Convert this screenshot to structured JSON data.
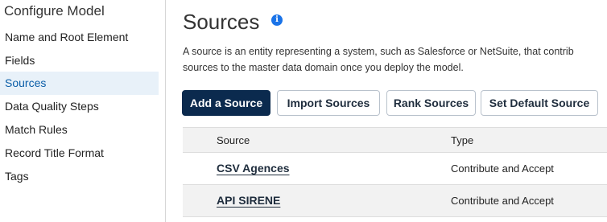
{
  "sidebar": {
    "title": "Configure Model",
    "items": [
      {
        "label": "Name and Root Element"
      },
      {
        "label": "Fields"
      },
      {
        "label": "Sources"
      },
      {
        "label": "Data Quality Steps"
      },
      {
        "label": "Match Rules"
      },
      {
        "label": "Record Title Format"
      },
      {
        "label": "Tags"
      }
    ],
    "active": "Sources"
  },
  "main": {
    "title": "Sources",
    "info_icon": "info-icon",
    "description_line1": "A source is an entity representing a system, such as Salesforce or NetSuite, that contrib",
    "description_line2": "sources to the master data domain once you deploy the model.",
    "buttons": {
      "add": "Add a Source",
      "import": "Import Sources",
      "rank": "Rank Sources",
      "set_default": "Set Default Source"
    },
    "table": {
      "headers": {
        "source": "Source",
        "type": "Type"
      },
      "rows": [
        {
          "source": "CSV Agences",
          "type": "Contribute and Accept"
        },
        {
          "source": "API SIRENE",
          "type": "Contribute and Accept"
        }
      ]
    }
  },
  "colors": {
    "primary_button": "#0b2a4e",
    "active_nav_bg": "#e8f1f9",
    "info_icon": "#1a73e8"
  }
}
